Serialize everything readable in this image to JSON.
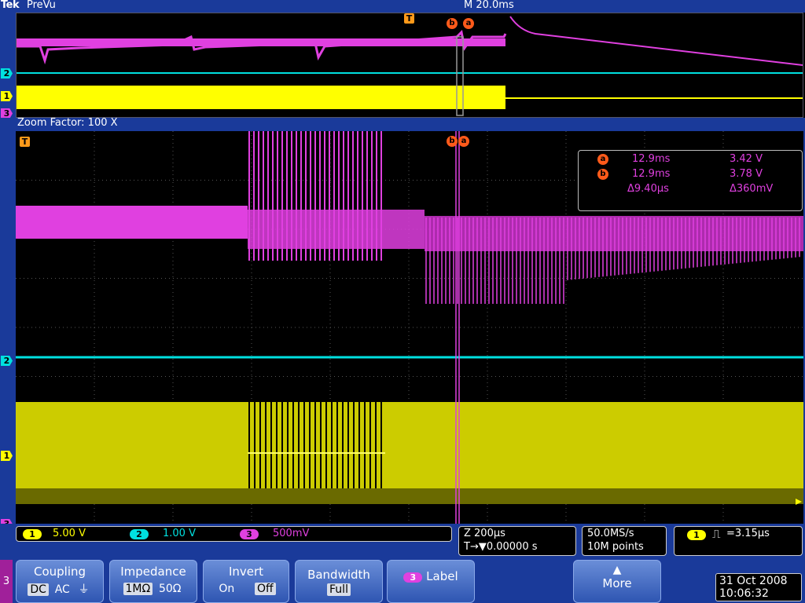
{
  "header": {
    "brand": "Tek",
    "mode": "PreVu",
    "timebase": "M 20.0ms"
  },
  "zoom": {
    "label": "Zoom Factor: 100 X"
  },
  "markers": {
    "trigger": "T",
    "cursor_a": "a",
    "cursor_b": "b",
    "ch1": "1",
    "ch2": "2",
    "ch3": "3"
  },
  "readout": {
    "a": {
      "label": "a",
      "time": "12.9ms",
      "value": "3.42 V"
    },
    "b": {
      "label": "b",
      "time": "12.9ms",
      "value": "3.78 V"
    },
    "delta": {
      "time": "Δ9.40μs",
      "value": "Δ360mV"
    }
  },
  "status": {
    "channels": [
      {
        "num": "1",
        "scale": "5.00 V",
        "color": "#ffff00"
      },
      {
        "num": "2",
        "scale": "1.00 V",
        "color": "#00e0e0"
      },
      {
        "num": "3",
        "scale": "500mV",
        "color": "#e040e0"
      }
    ],
    "zoom_time": "Z 200μs",
    "trigger_pos": "T→▼0.00000 s",
    "sample_rate": "50.0MS/s",
    "record_length": "10M points",
    "trigger_ch": "1",
    "trigger_value": "=3.15μs"
  },
  "menu": {
    "channel": "3",
    "coupling": {
      "title": "Coupling",
      "options": [
        "DC",
        "AC",
        "⏚"
      ],
      "selected": "DC"
    },
    "impedance": {
      "title": "Impedance",
      "options": [
        "1MΩ",
        "50Ω"
      ],
      "selected": "1MΩ"
    },
    "invert": {
      "title": "Invert",
      "options": [
        "On",
        "Off"
      ],
      "selected": "Off"
    },
    "bandwidth": {
      "title": "Bandwidth",
      "value": "Full"
    },
    "label": {
      "channel": "3",
      "title": "Label"
    },
    "more": {
      "title": "More"
    }
  },
  "datetime": {
    "date": "31 Oct  2008",
    "time": "10:06:32"
  },
  "colors": {
    "ch1": "#ffff00",
    "ch2": "#00e0e0",
    "ch3": "#e040e0",
    "cursor": "#ff5a1a",
    "frame": "#1a3a9a"
  }
}
